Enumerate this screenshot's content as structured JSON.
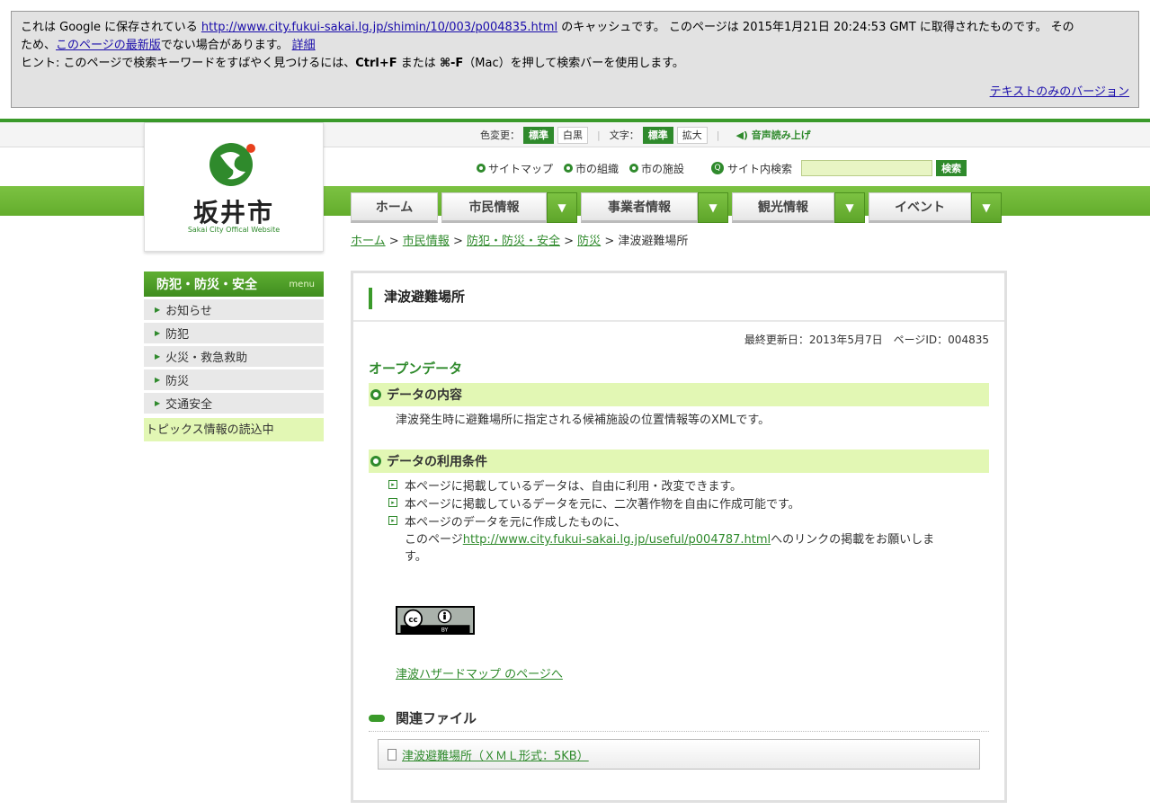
{
  "cache": {
    "line1_pre": "これは Google に保存されている ",
    "url": "http://www.city.fukui-sakai.lg.jp/shimin/10/003/p004835.html",
    "line1_post": " のキャッシュです。 このページは 2015年1月21日 20:24:53 GMT に取得されたものです。 その",
    "line2_pre": "ため、",
    "latest_link": "このページの最新版",
    "line2_mid": "でない場合があります。 ",
    "detail_link": "詳細",
    "hint_pre": "ヒント: このページで検索キーワードをすばやく見つけるには、",
    "hint_key1": "Ctrl+F",
    "hint_mid": " または ",
    "hint_key2": "⌘-F",
    "hint_post": "（Mac）を押して検索バーを使用します。",
    "text_only": "テキストのみのバージョン"
  },
  "util": {
    "color_label": "色変更：",
    "color_std": "標準",
    "color_bw": "白黒",
    "text_label": "文字：",
    "text_std": "標準",
    "text_large": "拡大",
    "voice": "音声読み上げ"
  },
  "logo": {
    "name": "坂井市",
    "sub": "Sakai City Offical Website"
  },
  "toplinks": {
    "sitemap": "サイトマップ",
    "org": "市の組織",
    "facilities": "市の施設",
    "search_label": "サイト内検索",
    "search_button": "検索"
  },
  "nav": [
    "ホーム",
    "市民情報",
    "事業者情報",
    "観光情報",
    "イベント"
  ],
  "breadcrumb": {
    "home": "ホーム",
    "c1": "市民情報",
    "c2": "防犯・防災・安全",
    "c3": "防災",
    "current": "津波避難場所",
    "sep": " > "
  },
  "sidebar": {
    "title": "防犯・防災・安全",
    "menu": "menu",
    "items": [
      "お知らせ",
      "防犯",
      "火災・救急救助",
      "防災",
      "交通安全"
    ],
    "topics": "トピックス情報の読込中"
  },
  "main": {
    "title": "津波避難場所",
    "updated": "最終更新日：2013年5月7日　ページID：004835",
    "open_data": "オープンデータ",
    "h_content": "データの内容",
    "content_text": "津波発生時に避難場所に指定される候補施設の位置情報等のXMLです。",
    "h_terms": "データの利用条件",
    "term1": "本ページに掲載しているデータは、自由に利用・改変できます。",
    "term2": "本ページに掲載しているデータを元に、二次著作物を自由に作成可能です。",
    "term3a": "本ページのデータを元に作成したものに、",
    "term3b_pre": "このページ",
    "term3b_link": "http://www.city.fukui-sakai.lg.jp/useful/p004787.html",
    "term3b_post": "へのリンクの掲載をお願いしま",
    "term3c": "す。",
    "cc_text": "BY",
    "hazard_link": "津波ハザードマップ のページへ",
    "related": "関連ファイル",
    "file_link": "津波避難場所（ＸＭＬ形式：5KB）"
  },
  "colors": {
    "brand_green": "#2f8a2c",
    "band_green": "#6cb535",
    "highlight": "#e2f7b4"
  }
}
